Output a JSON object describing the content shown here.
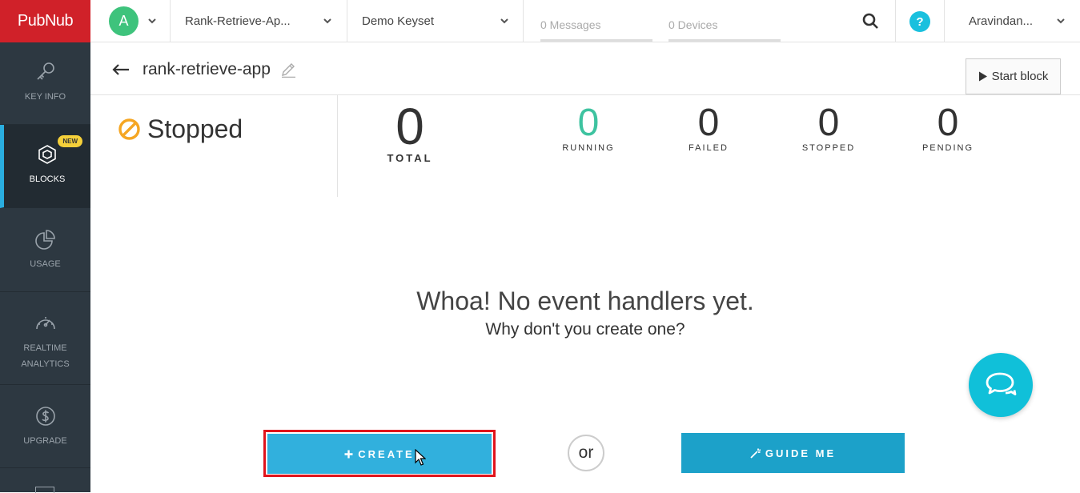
{
  "brand": {
    "logo_text": "PubNub",
    "color": "#d02129"
  },
  "sidebar": {
    "items": [
      {
        "label_lines": [
          "KEY INFO"
        ],
        "icon": "key-icon"
      },
      {
        "label_lines": [
          "BLOCKS"
        ],
        "icon": "blocks-icon",
        "active": true,
        "badge": "NEW"
      },
      {
        "label_lines": [
          "USAGE"
        ],
        "icon": "pie-chart-icon"
      },
      {
        "label_lines": [
          "REALTIME",
          "ANALYTICS"
        ],
        "icon": "speedometer-icon"
      },
      {
        "label_lines": [
          "UPGRADE"
        ],
        "icon": "dollar-icon"
      }
    ]
  },
  "topbar": {
    "avatar_initial": "A",
    "app_dropdown": "Rank-Retrieve-Ap...",
    "keyset_dropdown": "Demo Keyset",
    "messages": "0 Messages",
    "devices": "0 Devices",
    "help": "?",
    "user": "Aravindan..."
  },
  "header": {
    "title": "rank-retrieve-app",
    "start_button": "Start block"
  },
  "status": {
    "label": "Stopped",
    "color": "#f5a623"
  },
  "metrics": {
    "total": {
      "value": "0",
      "label": "TOTAL"
    },
    "running": {
      "value": "0",
      "label": "RUNNING",
      "color": "#3ec3a0"
    },
    "failed": {
      "value": "0",
      "label": "FAILED"
    },
    "stopped": {
      "value": "0",
      "label": "STOPPED"
    },
    "pending": {
      "value": "0",
      "label": "PENDING"
    }
  },
  "empty_state": {
    "title": "Whoa! No event handlers yet.",
    "subtitle": "Why don't you create one?"
  },
  "actions": {
    "create": "CREATE",
    "or": "or",
    "guide": "GUIDE ME"
  }
}
